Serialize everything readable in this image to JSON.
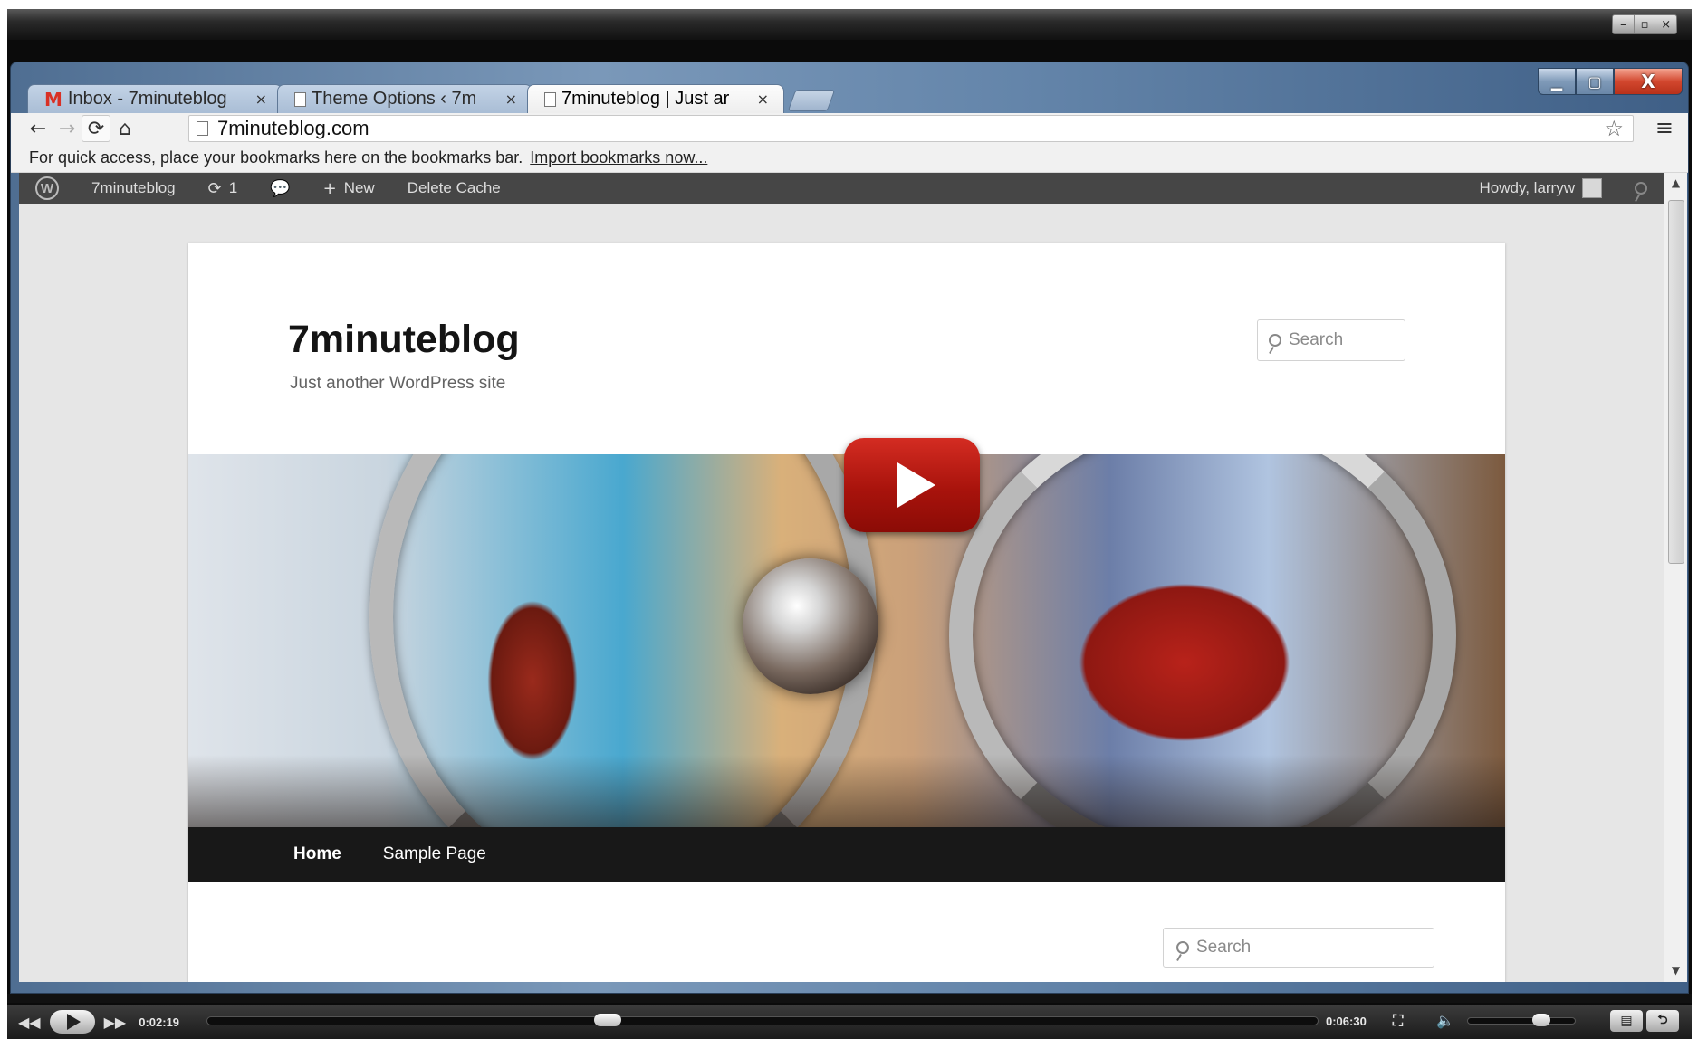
{
  "player": {
    "window_controls": [
      "–",
      "▫",
      "×"
    ],
    "current_time": "0:02:19",
    "total_time": "0:06:30",
    "progress": 0.357,
    "volume": 0.72,
    "icons": [
      "rewind-icon",
      "play-icon",
      "fast-forward-icon",
      "fullscreen-icon",
      "volume-icon",
      "mode-icon"
    ]
  },
  "browser": {
    "window_controls": {
      "minimize": "▁",
      "maximize": "▢",
      "close": "X"
    },
    "tabs": [
      {
        "favicon": "M",
        "label": "Inbox - 7minuteblog",
        "active": false
      },
      {
        "favicon": "page",
        "label": "Theme Options ‹ 7m",
        "active": false
      },
      {
        "favicon": "page",
        "label": "7minuteblog | Just ar",
        "active": true
      }
    ],
    "tab_close": "×",
    "toolbar": {
      "back": "←",
      "forward": "→",
      "reload": "⟳",
      "home": "⌂",
      "star": "☆",
      "menu": "≡"
    },
    "url": "7minuteblog.com",
    "bookmarks_bar": {
      "message": "For quick access, place your bookmarks here on the bookmarks bar.",
      "link": "Import bookmarks now..."
    }
  },
  "admin_bar": {
    "wp_logo": "W",
    "site_name": "7minuteblog",
    "updates_icon": "⟳",
    "updates_count": "1",
    "comments_icon": "💬",
    "new_icon": "+",
    "new_label": "New",
    "delete_cache": "Delete Cache",
    "howdy": "Howdy, larryw",
    "search_icon": "search-icon"
  },
  "scrollbar": {
    "up": "▲",
    "down": "▼"
  },
  "site": {
    "title": "7minuteblog",
    "tagline": "Just another WordPress site",
    "search_placeholder": "Search",
    "nav": [
      "Home",
      "Sample Page"
    ],
    "sidebar_search_placeholder": "Search"
  },
  "colors": {
    "admin_bar": "#464646",
    "nav_bar": "#181818",
    "play_button": "#c4211a",
    "browser_frame": "#6485aa"
  }
}
